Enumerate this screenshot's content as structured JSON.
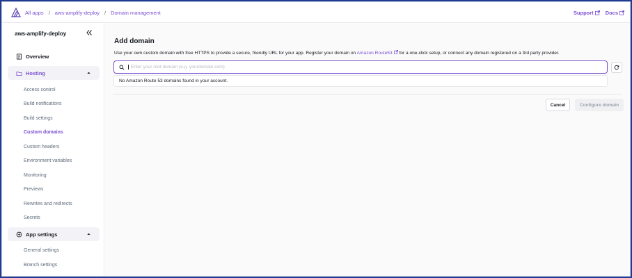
{
  "breadcrumb": {
    "items": [
      "All apps",
      "aws-amplify-deploy",
      "Domain management"
    ],
    "separator": "/"
  },
  "top_links": {
    "support": "Support",
    "docs": "Docs"
  },
  "sidebar": {
    "app_name": "aws-amplify-deploy",
    "overview": "Overview",
    "hosting": {
      "label": "Hosting",
      "items": [
        "Access control",
        "Build notifications",
        "Build settings",
        "Custom domains",
        "Custom headers",
        "Environment variables",
        "Monitoring",
        "Previews",
        "Rewrites and redirects",
        "Secrets"
      ],
      "active": "Custom domains"
    },
    "app_settings": {
      "label": "App settings",
      "items": [
        "General settings",
        "Branch settings"
      ]
    }
  },
  "main": {
    "title": "Add domain",
    "description_before": "Use your own custom domain with free HTTPS to provide a secure, friendly URL for your app. Register your domain on ",
    "description_link": "Amazon Route53",
    "description_after": " for a one-click setup, or connect any domain registered on a 3rd party provider.",
    "search_placeholder": "Enter your root domain (e.g. yourdomain.com)",
    "search_value": "",
    "dropdown_message": "No Amazon Route 53 domains found in your account.",
    "cancel_label": "Cancel",
    "configure_label": "Configure domain"
  },
  "colors": {
    "accent": "#7b4fd1",
    "frame": "#1f3a8f"
  },
  "icons": [
    "amplify-logo-icon",
    "external-link-icon",
    "collapse-sidebar-icon",
    "overview-icon",
    "hosting-icon",
    "app-settings-icon",
    "chevron-up-icon",
    "search-icon",
    "refresh-icon"
  ]
}
